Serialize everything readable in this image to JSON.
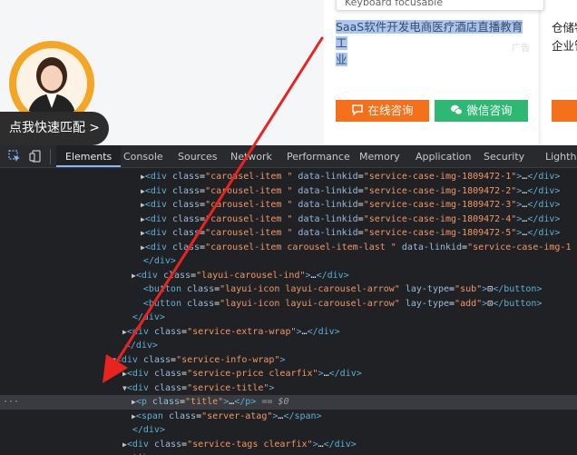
{
  "page": {
    "tooltip": "Keyboard focusable",
    "match_button": "点我快速匹配",
    "card1": {
      "title_line1": "SaaS软件开发电商医疗酒店直播教育工",
      "title_line2": "业",
      "btn_online": "在线咨询",
      "btn_wechat": "微信咨询"
    },
    "card2": {
      "title_line1": "仓储物",
      "title_line2": "企业管"
    }
  },
  "devtools": {
    "tabs": [
      "Elements",
      "Console",
      "Sources",
      "Network",
      "Performance",
      "Memory",
      "Application",
      "Security",
      "Lighthouse"
    ],
    "active_tab": "Elements",
    "lines": [
      {
        "indent": 166,
        "arrow": "▶",
        "parts": [
          [
            "tag",
            "<div "
          ],
          [
            "an",
            "class"
          ],
          [
            "tx",
            "="
          ],
          [
            "av",
            "\"carousel-item \""
          ],
          [
            "an",
            " data-linkid"
          ],
          [
            "tx",
            "="
          ],
          [
            "av",
            "\"service-case-img-1809472-1\""
          ],
          [
            "tag",
            ">"
          ],
          [
            "tx",
            "…"
          ],
          [
            "tag",
            "</div>"
          ]
        ]
      },
      {
        "indent": 166,
        "arrow": "▶",
        "parts": [
          [
            "tag",
            "<div "
          ],
          [
            "an",
            "class"
          ],
          [
            "tx",
            "="
          ],
          [
            "av",
            "\"carousel-item \""
          ],
          [
            "an",
            " data-linkid"
          ],
          [
            "tx",
            "="
          ],
          [
            "av",
            "\"service-case-img-1809472-2\""
          ],
          [
            "tag",
            ">"
          ],
          [
            "tx",
            "…"
          ],
          [
            "tag",
            "</div>"
          ]
        ]
      },
      {
        "indent": 166,
        "arrow": "▶",
        "parts": [
          [
            "tag",
            "<div "
          ],
          [
            "an",
            "class"
          ],
          [
            "tx",
            "="
          ],
          [
            "av",
            "\"carousel-item \""
          ],
          [
            "an",
            " data-linkid"
          ],
          [
            "tx",
            "="
          ],
          [
            "av",
            "\"service-case-img-1809472-3\""
          ],
          [
            "tag",
            ">"
          ],
          [
            "tx",
            "…"
          ],
          [
            "tag",
            "</div>"
          ]
        ]
      },
      {
        "indent": 166,
        "arrow": "▶",
        "parts": [
          [
            "tag",
            "<div "
          ],
          [
            "an",
            "class"
          ],
          [
            "tx",
            "="
          ],
          [
            "av",
            "\"carousel-item \""
          ],
          [
            "an",
            " data-linkid"
          ],
          [
            "tx",
            "="
          ],
          [
            "av",
            "\"service-case-img-1809472-4\""
          ],
          [
            "tag",
            ">"
          ],
          [
            "tx",
            "…"
          ],
          [
            "tag",
            "</div>"
          ]
        ]
      },
      {
        "indent": 166,
        "arrow": "▶",
        "parts": [
          [
            "tag",
            "<div "
          ],
          [
            "an",
            "class"
          ],
          [
            "tx",
            "="
          ],
          [
            "av",
            "\"carousel-item \""
          ],
          [
            "an",
            " data-linkid"
          ],
          [
            "tx",
            "="
          ],
          [
            "av",
            "\"service-case-img-1809472-5\""
          ],
          [
            "tag",
            ">"
          ],
          [
            "tx",
            "…"
          ],
          [
            "tag",
            "</div>"
          ]
        ]
      },
      {
        "indent": 166,
        "arrow": "▶",
        "parts": [
          [
            "tag",
            "<div "
          ],
          [
            "an",
            "class"
          ],
          [
            "tx",
            "="
          ],
          [
            "av",
            "\"carousel-item carousel-item-last \""
          ],
          [
            "an",
            " data-linkid"
          ],
          [
            "tx",
            "="
          ],
          [
            "av",
            "\"service-case-img-1"
          ]
        ]
      },
      {
        "indent": 164,
        "arrow": "",
        "parts": [
          [
            "tag",
            "</div>"
          ]
        ]
      },
      {
        "indent": 156,
        "arrow": "▶",
        "parts": [
          [
            "tag",
            "<div "
          ],
          [
            "an",
            "class"
          ],
          [
            "tx",
            "="
          ],
          [
            "av",
            "\"layui-carousel-ind\""
          ],
          [
            "tag",
            ">"
          ],
          [
            "tx",
            "…"
          ],
          [
            "tag",
            "</div>"
          ]
        ]
      },
      {
        "indent": 164,
        "arrow": "",
        "parts": [
          [
            "tag",
            "<button "
          ],
          [
            "an",
            "class"
          ],
          [
            "tx",
            "="
          ],
          [
            "av",
            "\"layui-icon layui-carousel-arrow\""
          ],
          [
            "an",
            " lay-type"
          ],
          [
            "tx",
            "="
          ],
          [
            "av",
            "\"sub\""
          ],
          [
            "tag",
            ">"
          ],
          [
            "tx",
            "⊡"
          ],
          [
            "tag",
            "</button>"
          ]
        ]
      },
      {
        "indent": 164,
        "arrow": "",
        "parts": [
          [
            "tag",
            "<button "
          ],
          [
            "an",
            "class"
          ],
          [
            "tx",
            "="
          ],
          [
            "av",
            "\"layui-icon layui-carousel-arrow\""
          ],
          [
            "an",
            " lay-type"
          ],
          [
            "tx",
            "="
          ],
          [
            "av",
            "\"add\""
          ],
          [
            "tag",
            ">"
          ],
          [
            "tx",
            "⊡"
          ],
          [
            "tag",
            "</button>"
          ]
        ]
      },
      {
        "indent": 152,
        "arrow": "",
        "parts": [
          [
            "tag",
            "</div>"
          ]
        ]
      },
      {
        "indent": 146,
        "arrow": "▶",
        "parts": [
          [
            "tag",
            "<div "
          ],
          [
            "an",
            "class"
          ],
          [
            "tx",
            "="
          ],
          [
            "av",
            "\"service-extra-wrap\""
          ],
          [
            "tag",
            ">"
          ],
          [
            "tx",
            "…"
          ],
          [
            "tag",
            "</div>"
          ]
        ]
      },
      {
        "indent": 144,
        "arrow": "",
        "parts": [
          [
            "tag",
            "</div>"
          ]
        ]
      },
      {
        "indent": 134,
        "arrow": "▼",
        "parts": [
          [
            "tag",
            "<div "
          ],
          [
            "an",
            "class"
          ],
          [
            "tx",
            "="
          ],
          [
            "av",
            "\"service-info-wrap\""
          ],
          [
            "tag",
            ">"
          ]
        ]
      },
      {
        "indent": 146,
        "arrow": "▶",
        "parts": [
          [
            "tag",
            "<div "
          ],
          [
            "an",
            "class"
          ],
          [
            "tx",
            "="
          ],
          [
            "av",
            "\"service-price clearfix\""
          ],
          [
            "tag",
            ">"
          ],
          [
            "tx",
            "…"
          ],
          [
            "tag",
            "</div>"
          ]
        ]
      },
      {
        "indent": 146,
        "arrow": "▼",
        "parts": [
          [
            "tag",
            "<div "
          ],
          [
            "an",
            "class"
          ],
          [
            "tx",
            "="
          ],
          [
            "av",
            "\"service-title\""
          ],
          [
            "tag",
            ">"
          ]
        ]
      },
      {
        "indent": 156,
        "arrow": "▶",
        "highlight": true,
        "dots": "···",
        "parts": [
          [
            "tag",
            "<p "
          ],
          [
            "an",
            "class"
          ],
          [
            "tx",
            "="
          ],
          [
            "av",
            "\"title\""
          ],
          [
            "tag",
            ">"
          ],
          [
            "tx",
            "…"
          ],
          [
            "tag",
            "</p>"
          ],
          [
            "eq",
            " == "
          ],
          [
            "pd",
            "$0"
          ]
        ]
      },
      {
        "indent": 156,
        "arrow": "▶",
        "parts": [
          [
            "tag",
            "<span "
          ],
          [
            "an",
            "class"
          ],
          [
            "tx",
            "="
          ],
          [
            "av",
            "\"server-atag\""
          ],
          [
            "tag",
            ">"
          ],
          [
            "tx",
            "…"
          ],
          [
            "tag",
            "</span>"
          ]
        ]
      },
      {
        "indent": 152,
        "arrow": "",
        "parts": [
          [
            "tag",
            "</div>"
          ]
        ]
      },
      {
        "indent": 146,
        "arrow": "▶",
        "parts": [
          [
            "tag",
            "<div "
          ],
          [
            "an",
            "class"
          ],
          [
            "tx",
            "="
          ],
          [
            "av",
            "\"service-tags clearfix\""
          ],
          [
            "tag",
            ">"
          ],
          [
            "tx",
            "…"
          ],
          [
            "tag",
            "</div>"
          ]
        ]
      },
      {
        "indent": 144,
        "arrow": "",
        "parts": [
          [
            "tag",
            "</div>"
          ]
        ]
      }
    ]
  }
}
